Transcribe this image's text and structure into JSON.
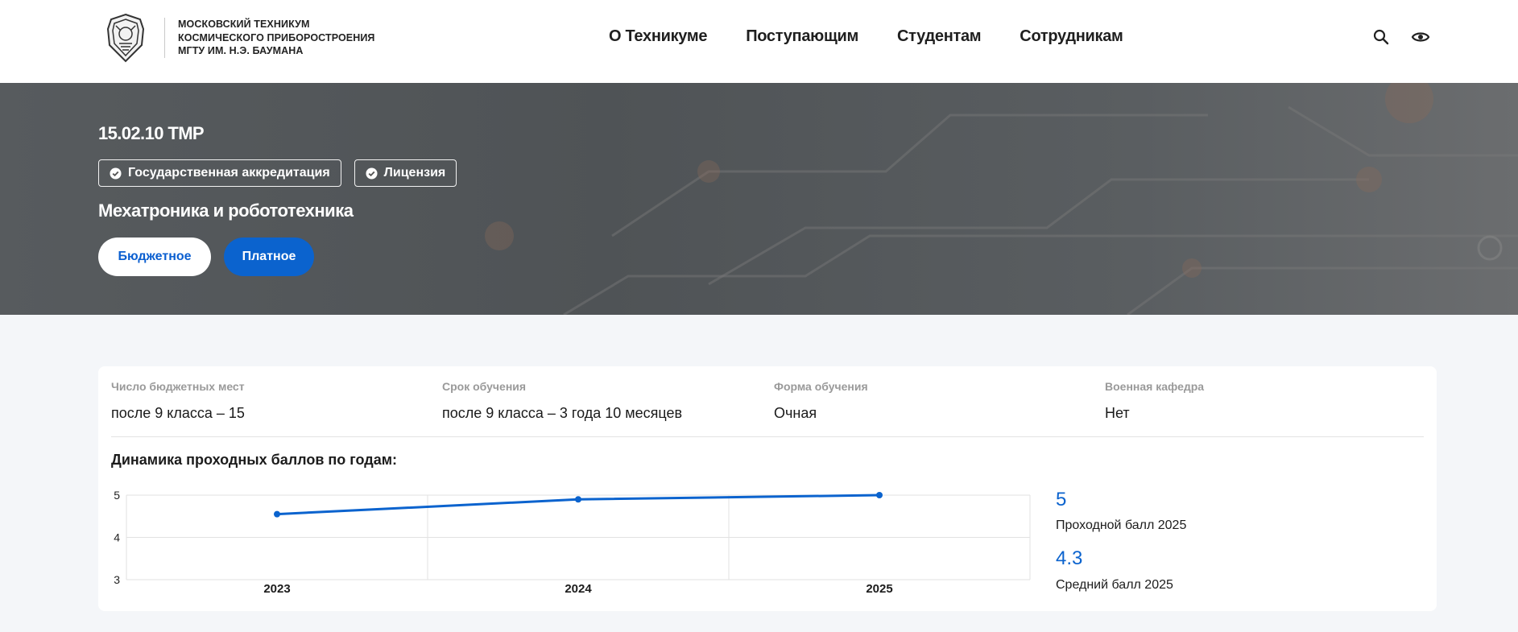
{
  "header": {
    "logo_lines": [
      "МОСКОВСКИЙ ТЕХНИКУМ",
      "КОСМИЧЕСКОГО ПРИБОРОСТРОЕНИЯ",
      "МГТУ ИМ. Н.Э. БАУМАНА"
    ],
    "nav": [
      "О Техникуме",
      "Поступающим",
      "Студентам",
      "Сотрудникам"
    ],
    "icons": [
      "search-icon",
      "eye-icon"
    ]
  },
  "hero": {
    "code": "15.02.10 ТМР",
    "badges": [
      "Государственная аккредитация",
      "Лицензия"
    ],
    "title": "Мехатроника и робототехника",
    "buttons": {
      "budget": "Бюджетное",
      "paid": "Платное"
    }
  },
  "info": [
    {
      "label": "Число бюджетных мест",
      "value": "после 9 класса – 15"
    },
    {
      "label": "Срок обучения",
      "value": "после 9 класса – 3 года 10 месяцев"
    },
    {
      "label": "Форма обучения",
      "value": "Очная"
    },
    {
      "label": "Военная кафедра",
      "value": "Нет"
    }
  ],
  "chart_title": "Динамика проходных баллов по годам:",
  "stats": [
    {
      "value": "5",
      "label": "Проходной балл 2025"
    },
    {
      "value": "4.3",
      "label": "Средний балл 2025"
    }
  ],
  "colors": {
    "accent": "#0b63ce",
    "hero_bg": "#53575a",
    "page_bg": "#f4f6f9"
  },
  "chart_data": {
    "type": "line",
    "categories": [
      "2023",
      "2024",
      "2025"
    ],
    "series": [
      {
        "values": [
          4.55,
          4.9,
          5.0
        ]
      }
    ],
    "yticks": [
      3,
      4,
      5
    ],
    "ylim": [
      3,
      5
    ],
    "title": "Динамика проходных баллов по годам:",
    "xlabel": "",
    "ylabel": "",
    "grid": true
  }
}
